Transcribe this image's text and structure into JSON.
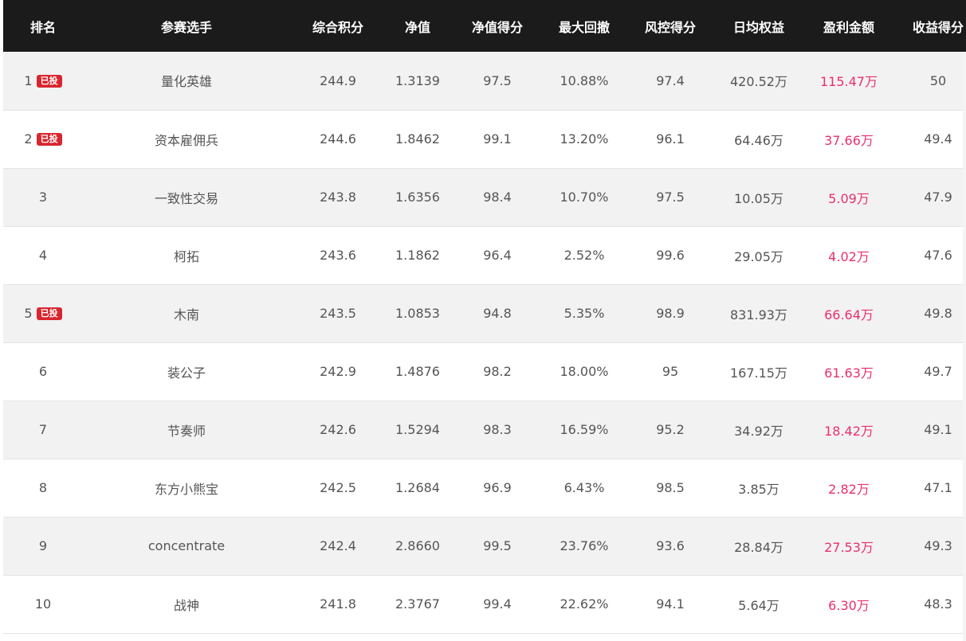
{
  "header": {
    "rank": "排名",
    "player": "参赛选手",
    "score": "综合积分",
    "nav": "净值",
    "nav_score": "净值得分",
    "max_drawdown": "最大回撤",
    "risk_score": "风控得分",
    "daily_equity": "日均权益",
    "profit": "盈利金额",
    "return_score": "收益得分"
  },
  "rows": [
    {
      "rank": "1",
      "badge": "已投",
      "player": "量化英雄",
      "score": "244.9",
      "nav": "1.3139",
      "nav_score": "97.5",
      "max_drawdown": "10.88%",
      "risk_score": "97.4",
      "daily_equity": "420.52万",
      "profit": "115.47万",
      "return_score": "50"
    },
    {
      "rank": "2",
      "badge": "已投",
      "player": "资本雇佣兵",
      "score": "244.6",
      "nav": "1.8462",
      "nav_score": "99.1",
      "max_drawdown": "13.20%",
      "risk_score": "96.1",
      "daily_equity": "64.46万",
      "profit": "37.66万",
      "return_score": "49.4"
    },
    {
      "rank": "3",
      "badge": "",
      "player": "一致性交易",
      "score": "243.8",
      "nav": "1.6356",
      "nav_score": "98.4",
      "max_drawdown": "10.70%",
      "risk_score": "97.5",
      "daily_equity": "10.05万",
      "profit": "5.09万",
      "return_score": "47.9"
    },
    {
      "rank": "4",
      "badge": "",
      "player": "柯拓",
      "score": "243.6",
      "nav": "1.1862",
      "nav_score": "96.4",
      "max_drawdown": "2.52%",
      "risk_score": "99.6",
      "daily_equity": "29.05万",
      "profit": "4.02万",
      "return_score": "47.6"
    },
    {
      "rank": "5",
      "badge": "已投",
      "player": "木南",
      "score": "243.5",
      "nav": "1.0853",
      "nav_score": "94.8",
      "max_drawdown": "5.35%",
      "risk_score": "98.9",
      "daily_equity": "831.93万",
      "profit": "66.64万",
      "return_score": "49.8"
    },
    {
      "rank": "6",
      "badge": "",
      "player": "装公子",
      "score": "242.9",
      "nav": "1.4876",
      "nav_score": "98.2",
      "max_drawdown": "18.00%",
      "risk_score": "95",
      "daily_equity": "167.15万",
      "profit": "61.63万",
      "return_score": "49.7"
    },
    {
      "rank": "7",
      "badge": "",
      "player": "节奏师",
      "score": "242.6",
      "nav": "1.5294",
      "nav_score": "98.3",
      "max_drawdown": "16.59%",
      "risk_score": "95.2",
      "daily_equity": "34.92万",
      "profit": "18.42万",
      "return_score": "49.1"
    },
    {
      "rank": "8",
      "badge": "",
      "player": "东方小熊宝",
      "score": "242.5",
      "nav": "1.2684",
      "nav_score": "96.9",
      "max_drawdown": "6.43%",
      "risk_score": "98.5",
      "daily_equity": "3.85万",
      "profit": "2.82万",
      "return_score": "47.1"
    },
    {
      "rank": "9",
      "badge": "",
      "player": "concentrate",
      "score": "242.4",
      "nav": "2.8660",
      "nav_score": "99.5",
      "max_drawdown": "23.76%",
      "risk_score": "93.6",
      "daily_equity": "28.84万",
      "profit": "27.53万",
      "return_score": "49.3"
    },
    {
      "rank": "10",
      "badge": "",
      "player": "战神",
      "score": "241.8",
      "nav": "2.3767",
      "nav_score": "99.4",
      "max_drawdown": "22.62%",
      "risk_score": "94.1",
      "daily_equity": "5.64万",
      "profit": "6.30万",
      "return_score": "48.3"
    }
  ],
  "colors": {
    "header_bg": "#1b1b1b",
    "badge_bg": "#d8262f",
    "profit_text": "#e8306b",
    "row_alt_bg": "#f2f2f2"
  }
}
